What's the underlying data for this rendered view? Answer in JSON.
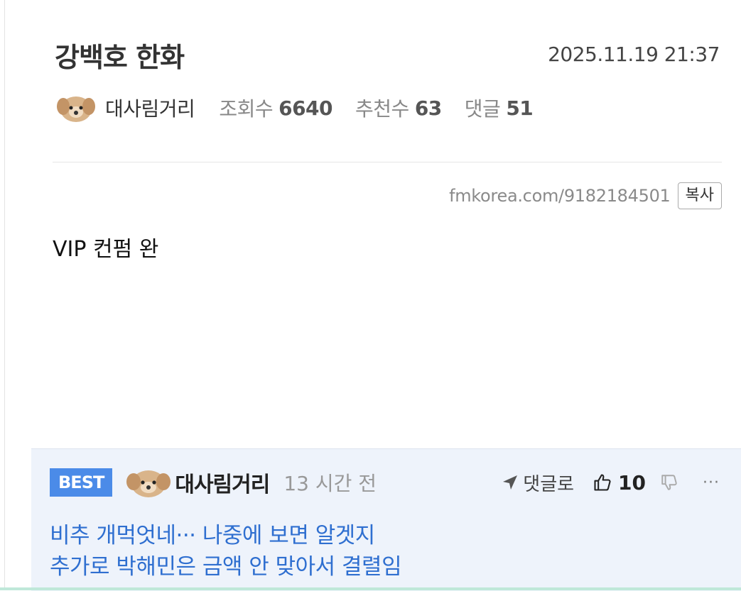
{
  "post": {
    "title": "강백호 한화",
    "date": "2025.11.19 21:37",
    "author": "대사림거리",
    "views_label": "조회수",
    "views": "6640",
    "recommend_label": "추천수",
    "recommend": "63",
    "comments_label": "댓글",
    "comments": "51",
    "url": "fmkorea.com/9182184501",
    "copy_label": "복사",
    "body": "VIP 컨펌 완"
  },
  "best_comment": {
    "badge": "BEST",
    "author": "대사림거리",
    "time": "13 시간 전",
    "reply_label": "댓글로",
    "upvotes": "10",
    "more_label": "···",
    "lines": [
      "비추 개먹엇네··· 나중에 보면 알겟지",
      "추가로 박해민은 금액 안 맞아서 결렬임"
    ]
  },
  "colors": {
    "best_badge": "#4b8be8",
    "comment_text": "#2f6fd0",
    "comment_bg": "#eef3fb"
  },
  "icons": [
    "dog-avatar-icon",
    "reply-arrow-icon",
    "thumbs-up-icon",
    "thumbs-down-icon",
    "more-icon"
  ]
}
